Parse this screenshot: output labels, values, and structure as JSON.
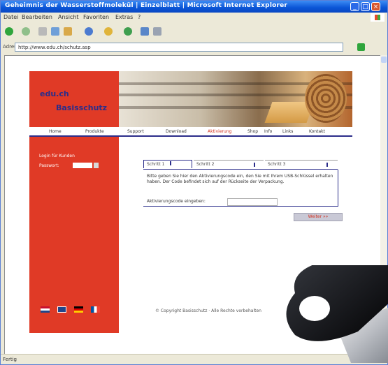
{
  "window": {
    "title": "Geheimnis der Wasserstoffmolekül | Einzelblatt | Microsoft Internet Explorer",
    "controls": {
      "minimize": "_",
      "maximize": "□",
      "close": "×"
    }
  },
  "menubar": {
    "items": [
      "Datei",
      "Bearbeiten",
      "Ansicht",
      "Favoriten",
      "Extras",
      "?"
    ]
  },
  "toolbar": {
    "icons": [
      "back-icon",
      "forward-icon",
      "stop-icon",
      "refresh-icon",
      "home-icon",
      "search-icon",
      "favorites-icon",
      "history-icon",
      "mail-icon",
      "print-icon"
    ]
  },
  "addressbar": {
    "label": "Adresse",
    "url": "http://www.edu.ch/schutz.asp"
  },
  "site": {
    "logo_line1": "edu.ch",
    "logo_line2": "Basisschutz",
    "nav": [
      {
        "label": "Home",
        "active": false
      },
      {
        "label": "Produkte",
        "active": false
      },
      {
        "label": "Support",
        "active": false
      },
      {
        "label": "Download",
        "active": false
      },
      {
        "label": "Aktivierung",
        "active": true
      },
      {
        "label": "Shop",
        "active": false
      },
      {
        "label": "Info",
        "active": false
      },
      {
        "label": "Links",
        "active": false
      },
      {
        "label": "Kontakt",
        "active": false
      }
    ],
    "login": {
      "line1": "Login für Kunden",
      "line2": "Passwort:"
    },
    "tabs": [
      {
        "label": "Schritt 1",
        "active": true
      },
      {
        "label": "Schritt 2",
        "active": false
      },
      {
        "label": "Schritt 3",
        "active": false
      }
    ],
    "panel_text": "Bitte geben Sie hier den Aktivierungscode ein, den Sie mit Ihrem USB-Schlüssel erhalten haben. Der Code befindet sich auf der Rückseite der Verpackung.",
    "field_label": "Aktivierungscode eingeben:",
    "submit_label": "Weiter »»",
    "footer": "© Copyright Basisschutz · Alle Rechte vorbehalten"
  },
  "statusbar": {
    "text": "Fertig"
  }
}
